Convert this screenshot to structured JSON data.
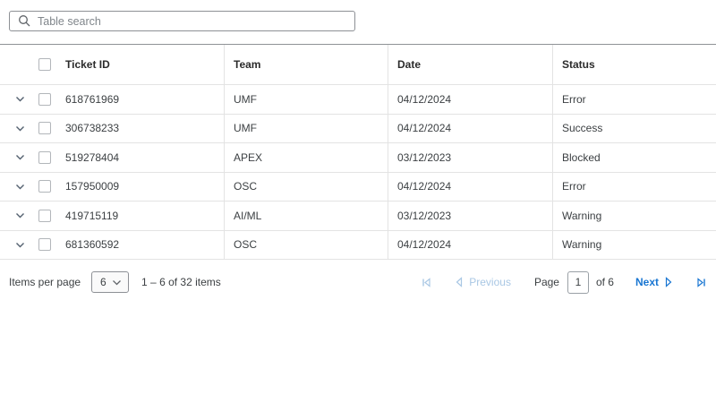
{
  "search": {
    "placeholder": "Table search"
  },
  "table": {
    "columns": [
      "Ticket ID",
      "Team",
      "Date",
      "Status"
    ],
    "rows": [
      {
        "ticket_id": "618761969",
        "team": "UMF",
        "date": "04/12/2024",
        "status": "Error"
      },
      {
        "ticket_id": "306738233",
        "team": "UMF",
        "date": "04/12/2024",
        "status": "Success"
      },
      {
        "ticket_id": "519278404",
        "team": "APEX",
        "date": "03/12/2023",
        "status": "Blocked"
      },
      {
        "ticket_id": "157950009",
        "team": "OSC",
        "date": "04/12/2024",
        "status": "Error"
      },
      {
        "ticket_id": "419715119",
        "team": "AI/ML",
        "date": "03/12/2023",
        "status": "Warning"
      },
      {
        "ticket_id": "681360592",
        "team": "OSC",
        "date": "04/12/2024",
        "status": "Warning"
      }
    ]
  },
  "pagination": {
    "items_per_page_label": "Items per page",
    "items_per_page_value": "6",
    "range_text": "1 – 6 of 32 items",
    "previous_label": "Previous",
    "page_label": "Page",
    "page_value": "1",
    "of_label": "of 6",
    "next_label": "Next"
  },
  "colors": {
    "accent_blue": "#1976d2",
    "disabled_blue": "#a9c7e4",
    "border_dark": "#8f9296",
    "border_light": "#e3e3e3",
    "text_primary": "#3c4043"
  }
}
